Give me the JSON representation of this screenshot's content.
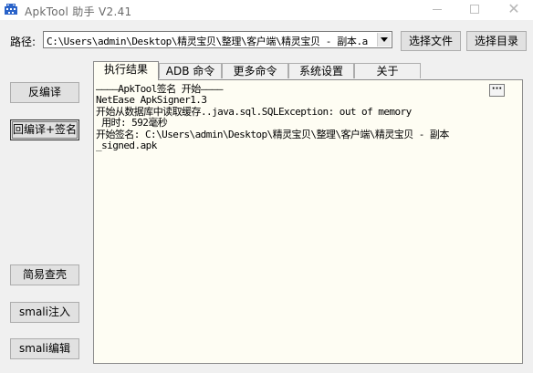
{
  "window": {
    "title": "ApkTool 助手 V2.41",
    "icon": "android-robot-icon",
    "controls": {
      "minimize": "minimize-icon",
      "maximize": "maximize-icon",
      "close": "✕"
    }
  },
  "path": {
    "label": "路径:",
    "value": "C:\\Users\\admin\\Desktop\\精灵宝贝\\整理\\客户端\\精灵宝贝 - 副本.a",
    "select_file": "选择文件",
    "select_dir": "选择目录"
  },
  "left_buttons": {
    "decompile": "反编译",
    "recompile_sign": "回编译+签名",
    "simple_shell": "简易查壳",
    "smali_inject": "smali注入",
    "smali_edit": "smali编辑"
  },
  "tabs": [
    "执行结果",
    "ADB 命令",
    "更多命令",
    "系统设置",
    "关于"
  ],
  "active_tab": 0,
  "output": {
    "more_label": "···",
    "text": "————ApkTool签名 开始————\nNetEase ApkSigner1.3\n开始从数据库中读取缓存..java.sql.SQLException: out of memory\n 用时: 592毫秒\n开始签名: C:\\Users\\admin\\Desktop\\精灵宝贝\\整理\\客户端\\精灵宝贝 - 副本\n_signed.apk"
  },
  "colors": {
    "window_bg": "#f0f0f0",
    "output_bg": "#fefdf3",
    "button_bg": "#e1e1e1"
  }
}
